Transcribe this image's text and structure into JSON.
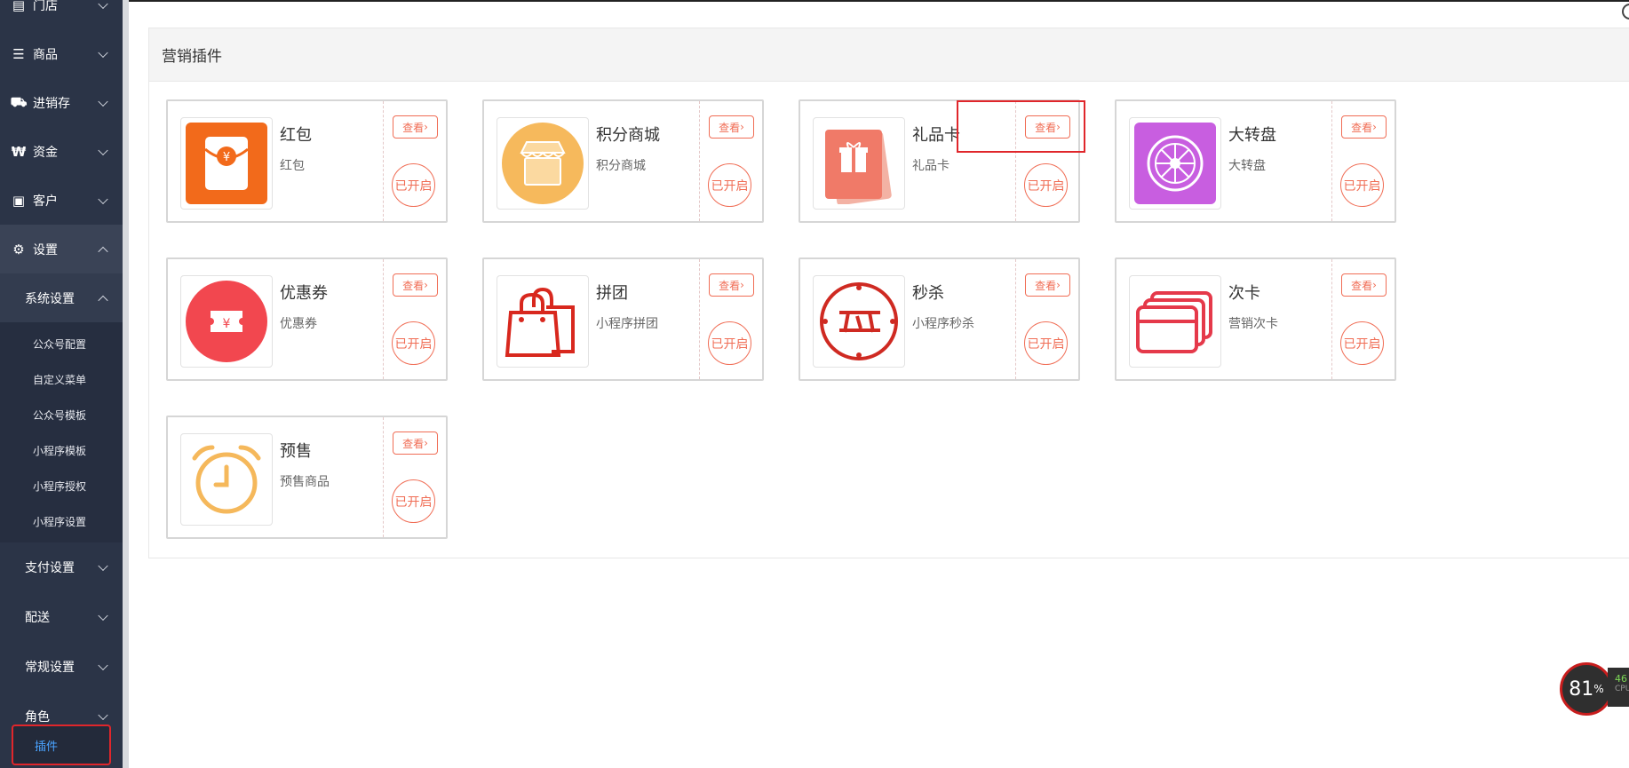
{
  "sidebar": {
    "items": [
      {
        "label": "门店",
        "icon": "store-icon",
        "glyph": "▤"
      },
      {
        "label": "商品",
        "icon": "list-icon",
        "glyph": "☰"
      },
      {
        "label": "进销存",
        "icon": "truck-icon",
        "glyph": "⛟"
      },
      {
        "label": "资金",
        "icon": "won-icon",
        "glyph": "₩"
      },
      {
        "label": "客户",
        "icon": "id-card-icon",
        "glyph": "▣"
      },
      {
        "label": "设置",
        "icon": "gear-icon",
        "glyph": "⚙"
      }
    ],
    "system_settings": {
      "label": "系统设置",
      "children": [
        "公众号配置",
        "自定义菜单",
        "公众号模板",
        "小程序模板",
        "小程序授权",
        "小程序设置"
      ]
    },
    "level2": [
      "支付设置",
      "配送",
      "常规设置",
      "角色"
    ],
    "active_item": "插件"
  },
  "panel": {
    "title": "营销插件",
    "view_label": "查看",
    "status_label": "已开启",
    "cards": [
      {
        "title": "红包",
        "desc": "红包",
        "icon": "red-packet-icon",
        "color": "#f26a1b"
      },
      {
        "title": "积分商城",
        "desc": "积分商城",
        "icon": "store-front-icon",
        "color": "#f6b95c"
      },
      {
        "title": "礼品卡",
        "desc": "礼品卡",
        "icon": "gift-card-icon",
        "color": "#f07a68"
      },
      {
        "title": "大转盘",
        "desc": "大转盘",
        "icon": "wheel-icon",
        "color": "#c85ee0"
      },
      {
        "title": "优惠券",
        "desc": "优惠券",
        "icon": "coupon-icon",
        "color": "#f2474f"
      },
      {
        "title": "拼团",
        "desc": "小程序拼团",
        "icon": "shopping-bag-icon",
        "color": "#d8281e"
      },
      {
        "title": "秒杀",
        "desc": "小程序秒杀",
        "icon": "flash-sale-icon",
        "color": "#cf2a22"
      },
      {
        "title": "次卡",
        "desc": "营销次卡",
        "icon": "cards-icon",
        "color": "#e5394a"
      },
      {
        "title": "预售",
        "desc": "预售商品",
        "icon": "alarm-clock-icon",
        "color": "#f5b85b"
      }
    ]
  },
  "cpu": {
    "percent": "81",
    "unit": "%",
    "side_value": "46",
    "side_label": "CPU"
  }
}
